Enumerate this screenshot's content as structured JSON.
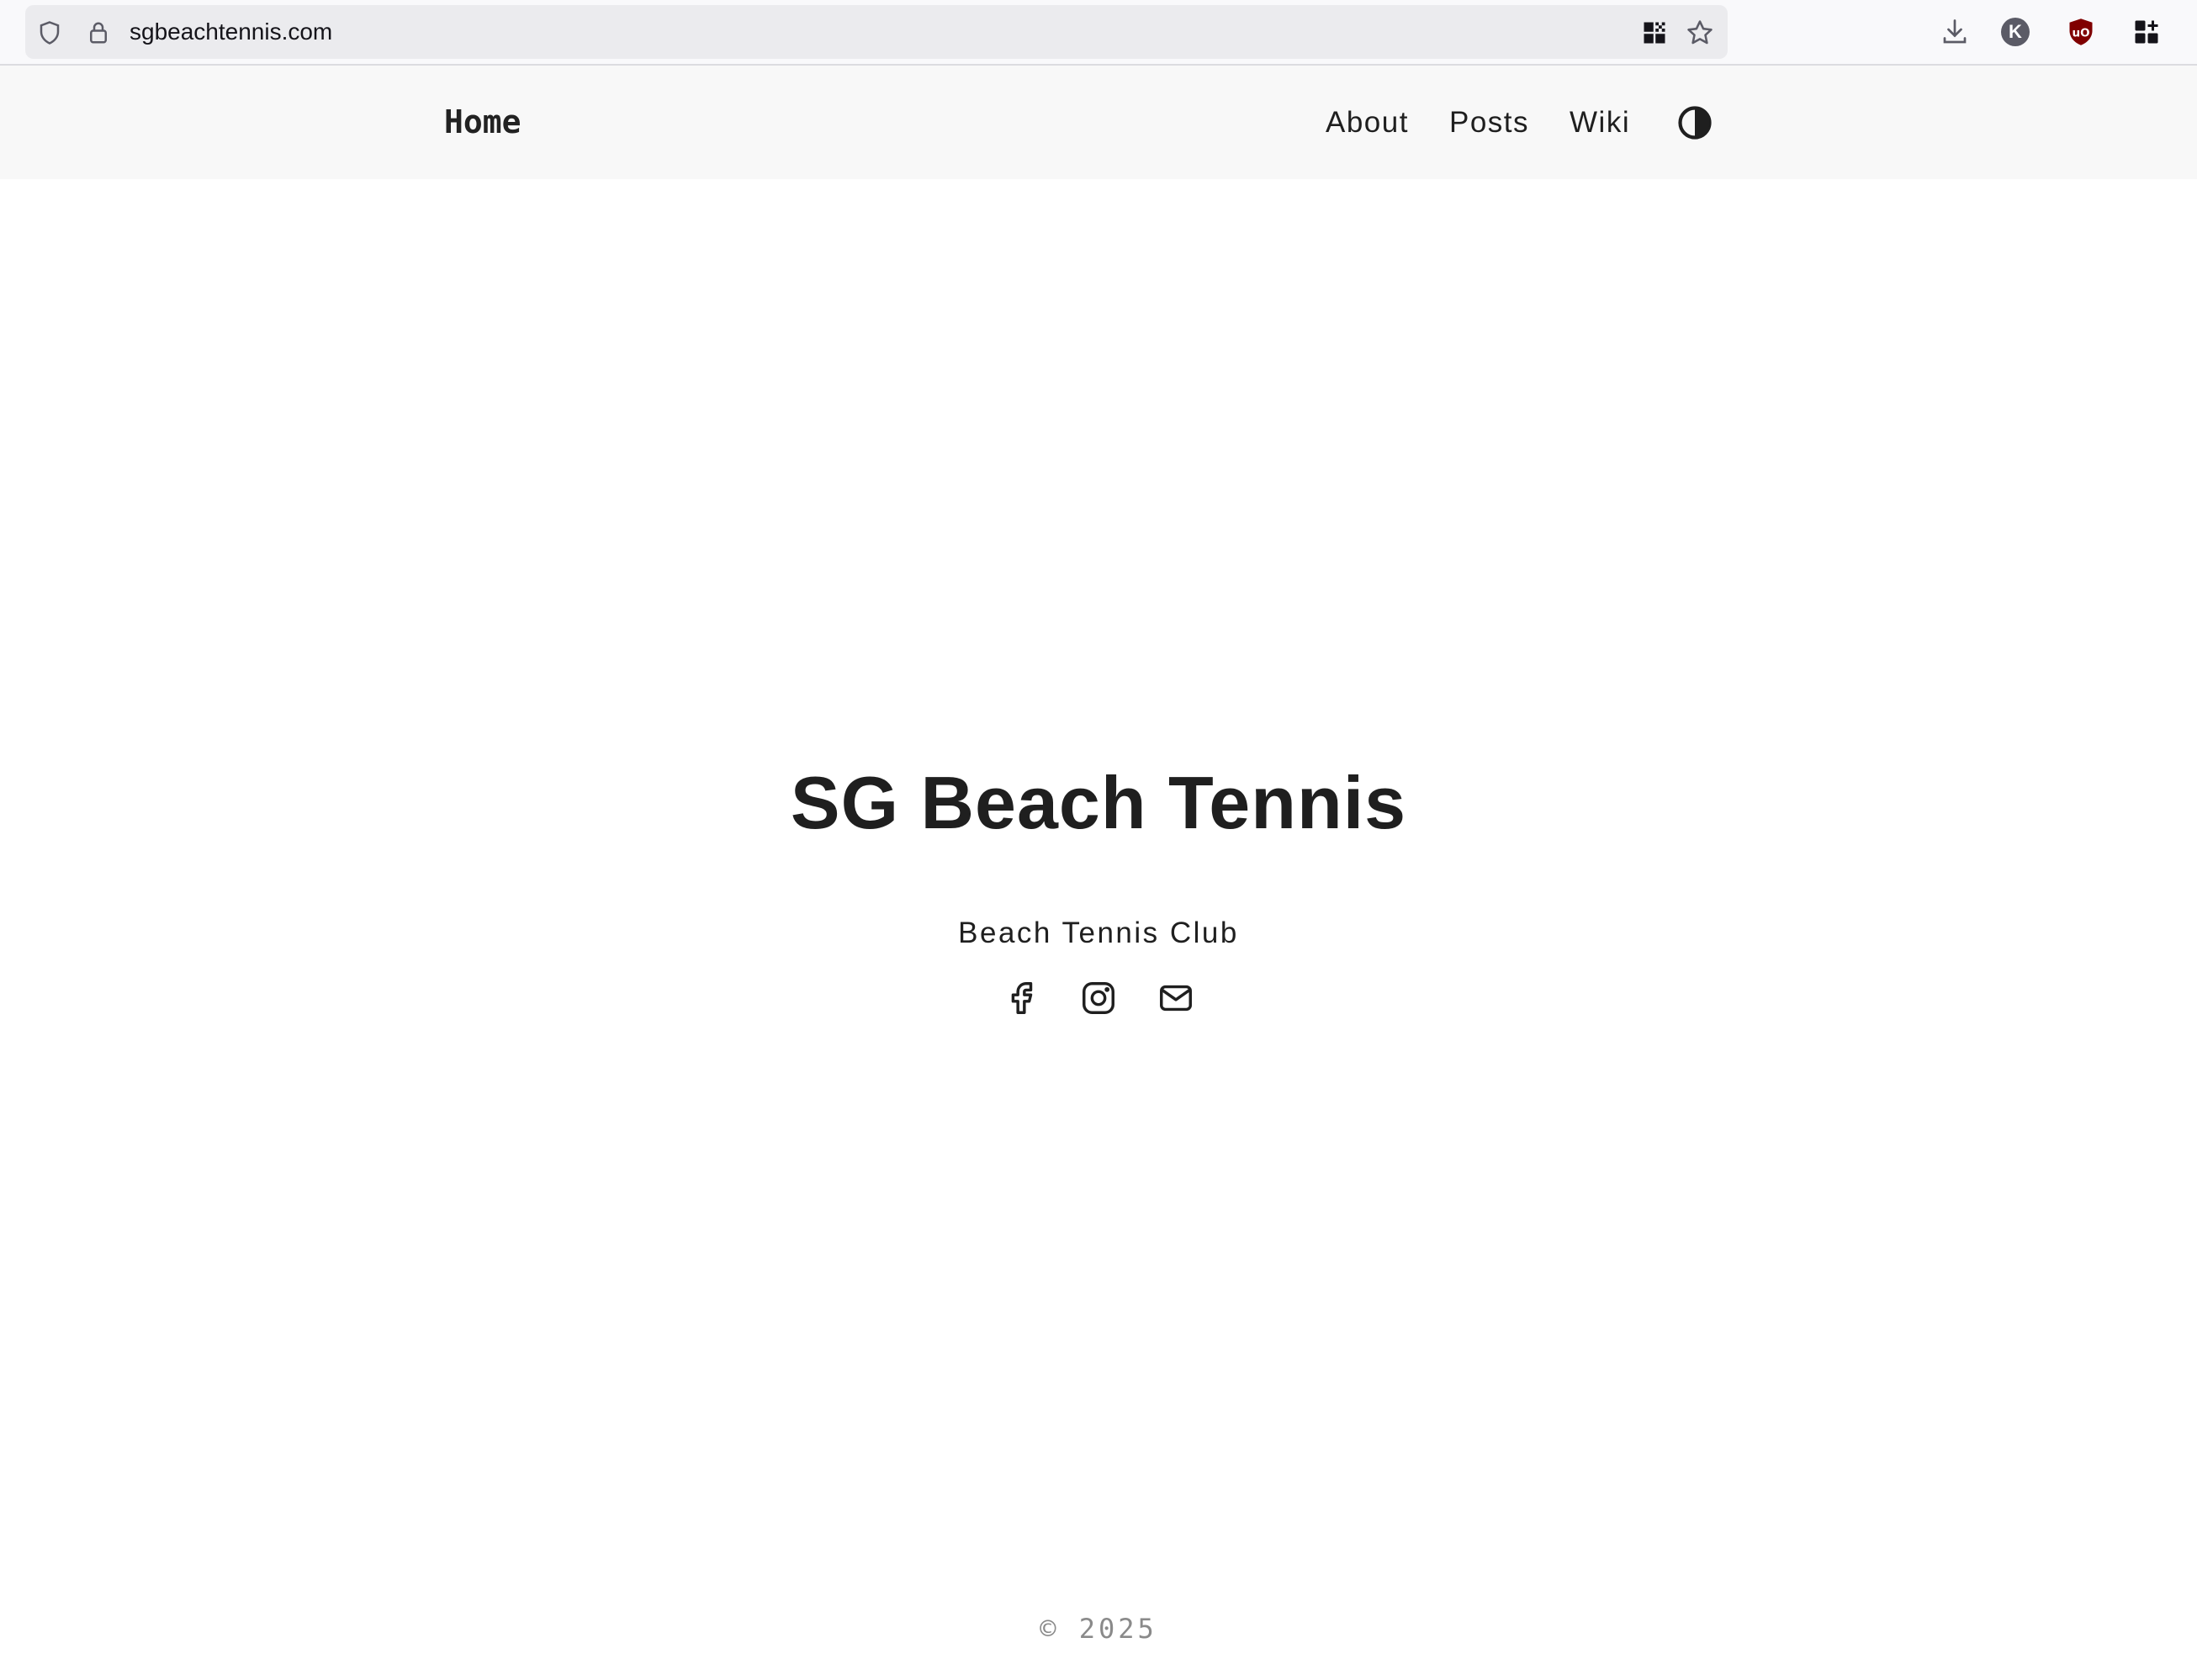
{
  "browser": {
    "url": "sgbeachtennis.com",
    "icons": [
      "shield-icon",
      "lock-icon",
      "qr-code-icon",
      "star-icon",
      "download-icon",
      "account-icon",
      "ublock-icon",
      "extensions-icon"
    ],
    "account_initial": "K",
    "ublock_label": "uO"
  },
  "header": {
    "home_label": "Home",
    "nav": [
      {
        "label": "About"
      },
      {
        "label": "Posts"
      },
      {
        "label": "Wiki"
      }
    ],
    "theme_toggle_icon": "contrast-icon"
  },
  "hero": {
    "title": "SG Beach Tennis",
    "subtitle": "Beach Tennis Club",
    "socials": [
      "facebook-icon",
      "instagram-icon",
      "mail-icon"
    ]
  },
  "footer": {
    "copyright": "© 2025"
  },
  "colors": {
    "text": "#1f1f1f",
    "header_bg": "#f8f8f8",
    "footer_text": "#8a8a8a",
    "ublock_red": "#800000"
  }
}
